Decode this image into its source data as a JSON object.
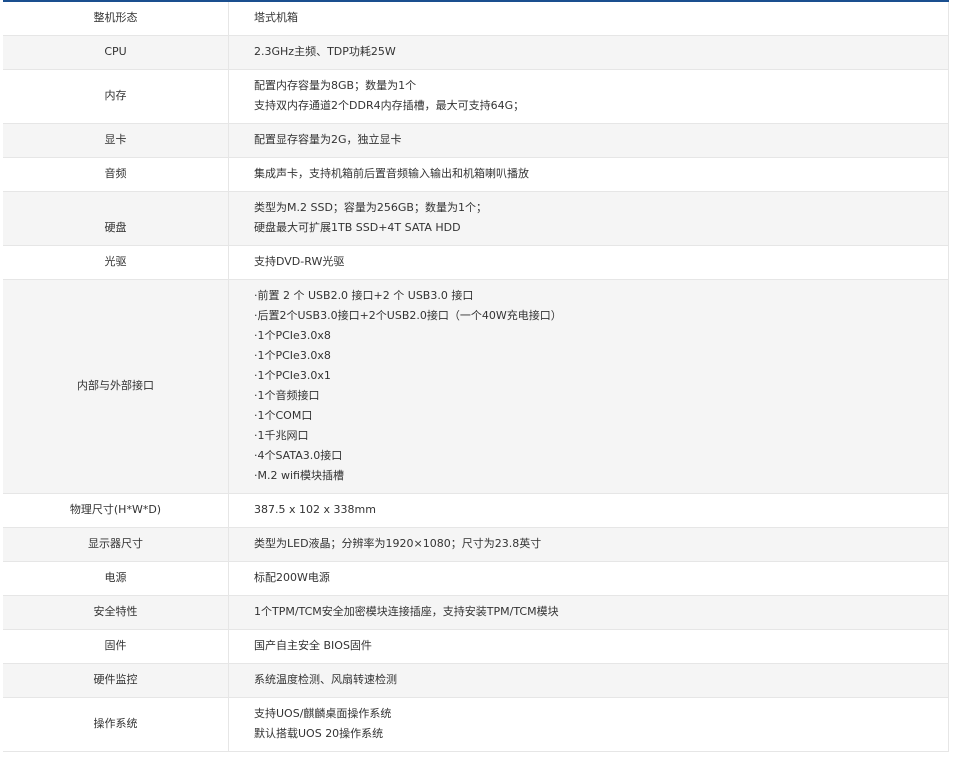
{
  "specs": [
    {
      "label": "整机形态",
      "lines": [
        "塔式机箱"
      ]
    },
    {
      "label": "CPU",
      "lines": [
        "2.3GHz主频、TDP功耗25W"
      ]
    },
    {
      "label": "内存",
      "lines": [
        "配置内存容量为8GB；数量为1个",
        "支持双内存通道2个DDR4内存插槽，最大可支持64G；"
      ]
    },
    {
      "label": "显卡",
      "lines": [
        "配置显存容量为2G，独立显卡"
      ]
    },
    {
      "label": "音频",
      "lines": [
        "集成声卡，支持机箱前后置音频输入输出和机箱喇叭播放"
      ]
    },
    {
      "label": "硬盘",
      "lines": [
        "类型为M.2 SSD；容量为256GB；数量为1个；",
        "硬盘最大可扩展1TB SSD+4T SATA HDD"
      ]
    },
    {
      "label": "光驱",
      "lines": [
        "支持DVD-RW光驱"
      ]
    },
    {
      "label": "内部与外部接口",
      "lines": [
        "·前置 2 个 USB2.0 接口+2 个 USB3.0 接口",
        "·后置2个USB3.0接口+2个USB2.0接口（一个40W充电接口）",
        "·1个PCIe3.0x8",
        "·1个PCIe3.0x8",
        "·1个PCIe3.0x1",
        "·1个音频接口",
        "·1个COM口",
        "·1千兆网口",
        "·4个SATA3.0接口",
        "·M.2 wifi模块插槽"
      ]
    },
    {
      "label": "物理尺寸(H*W*D)",
      "lines": [
        "387.5 x 102 x 338mm"
      ]
    },
    {
      "label": "显示器尺寸",
      "lines": [
        "类型为LED液晶；分辨率为1920×1080；尺寸为23.8英寸"
      ]
    },
    {
      "label": "电源",
      "lines": [
        "标配200W电源"
      ]
    },
    {
      "label": "安全特性",
      "lines": [
        "1个TPM/TCM安全加密模块连接插座，支持安装TPM/TCM模块"
      ]
    },
    {
      "label": "固件",
      "lines": [
        "国产自主安全 BIOS固件"
      ]
    },
    {
      "label": "硬件监控",
      "lines": [
        "系统温度检测、风扇转速检测"
      ]
    },
    {
      "label": "操作系统",
      "lines": [
        "支持UOS/麒麟桌面操作系统",
        "默认搭载UOS 20操作系统"
      ]
    }
  ]
}
